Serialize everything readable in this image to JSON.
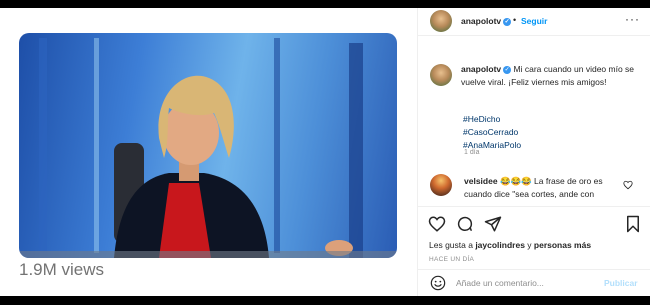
{
  "media": {
    "views": "1.9M views"
  },
  "post": {
    "username": "anapolotv",
    "follow_label": "Seguir",
    "more_icon": "more-horizontal-icon",
    "caption": "Mi cara cuando un video mío se vuelve viral. ¡Feliz viernes mis amigos!",
    "hashtags": [
      "#HeDicho",
      "#CasoCerrado",
      "#AnaMariaPolo"
    ],
    "time_ago": "1 día",
    "comment": {
      "username": "velsidee",
      "text": "😂😂😂 La frase de oro es cuando dice \"sea cortes, ande con cuidado\""
    },
    "likes": {
      "prefix": "Les gusta a ",
      "user": "jaycolindres",
      "middle": " y ",
      "others": "personas más"
    },
    "posted_ago": "HACE UN DÍA",
    "comment_input": {
      "placeholder": "Añade un comentario...",
      "publish_label": "Publicar"
    }
  },
  "colors": {
    "accent": "#0095f6",
    "publish_disabled": "#b2dffc",
    "hashtag": "#00376b",
    "muted": "#8e8e8e"
  }
}
